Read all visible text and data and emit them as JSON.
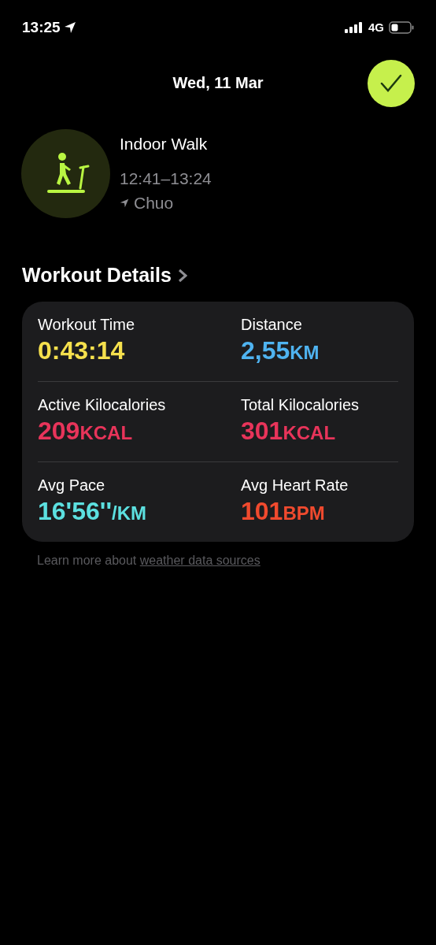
{
  "status_bar": {
    "time": "13:25",
    "network": "4G"
  },
  "header": {
    "date": "Wed, 11 Mar"
  },
  "workout": {
    "name": "Indoor Walk",
    "time_range": "12:41–13:24",
    "location": "Chuo"
  },
  "section": {
    "title": "Workout Details"
  },
  "metrics": [
    {
      "label": "Workout Time",
      "value": "0:43:14",
      "color": "#f5e04d"
    },
    {
      "label": "Distance",
      "value": "2,55",
      "unit": "KM",
      "color": "#4fb3f0"
    },
    {
      "label": "Active Kilocalories",
      "value": "209",
      "unit": "KCAL",
      "color": "#e8345a"
    },
    {
      "label": "Total Kilocalories",
      "value": "301",
      "unit": "KCAL",
      "color": "#e8345a"
    },
    {
      "label": "Avg Pace",
      "value": "16'56''",
      "unit": "/KM",
      "color": "#5ce0e0"
    },
    {
      "label": "Avg Heart Rate",
      "value": "101",
      "unit": "BPM",
      "color": "#f04a2e"
    }
  ],
  "footer": {
    "text": "Learn more about",
    "link": "weather data sources"
  }
}
